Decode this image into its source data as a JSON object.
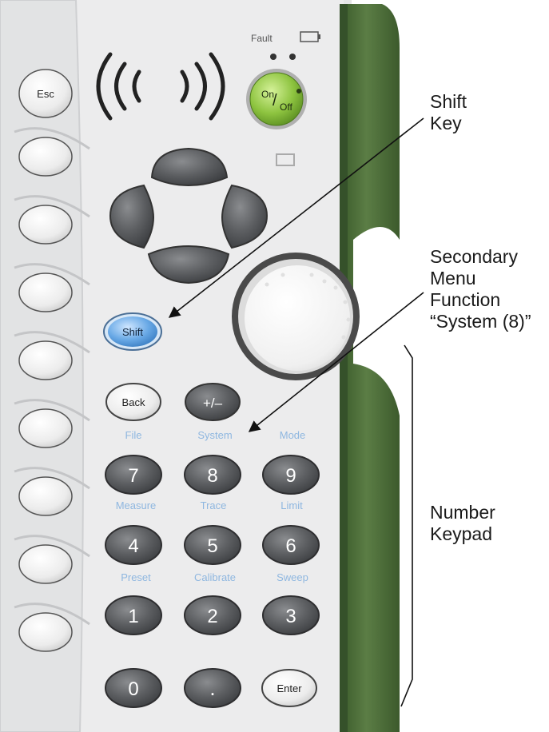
{
  "device": {
    "status": {
      "fault_label": "Fault"
    },
    "power_button": {
      "on_text": "On",
      "slash": "/",
      "off_text": "Off"
    },
    "keys": {
      "esc": "Esc",
      "shift": "Shift",
      "back": "Back",
      "plus_minus": "+/–",
      "k7": "7",
      "k8": "8",
      "k9": "9",
      "k4": "4",
      "k5": "5",
      "k6": "6",
      "k1": "1",
      "k2": "2",
      "k3": "3",
      "k0": "0",
      "dot": ".",
      "enter": "Enter"
    },
    "secondary_functions": {
      "file": "File",
      "system": "System",
      "mode": "Mode",
      "measure": "Measure",
      "trace": "Trace",
      "limit": "Limit",
      "preset": "Preset",
      "calibrate": "Calibrate",
      "sweep": "Sweep"
    },
    "colors": {
      "panel": "#ececed",
      "bezel_green": "#4c6b3a",
      "secondary_label_blue": "#8fb7e0",
      "shift_key_blue": "#5d9fe0",
      "power_key_green": "#8ec440",
      "dark_key": "#5d5f62"
    }
  },
  "callouts": {
    "shift_key": "Shift\nKey",
    "secondary_menu": "Secondary\nMenu\nFunction\n“System (8)”",
    "number_keypad": "Number\nKeypad"
  }
}
